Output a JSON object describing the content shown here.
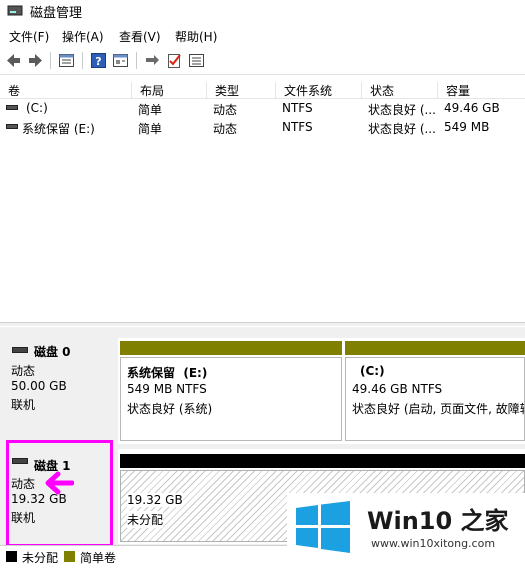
{
  "window": {
    "title": "磁盘管理"
  },
  "menu": [
    "文件(F)",
    "操作(A)",
    "查看(V)",
    "帮助(H)"
  ],
  "toolbar": {
    "icons": [
      "back-arrow-icon",
      "forward-arrow-icon",
      "properties-icon",
      "help-icon",
      "console-icon",
      "connect-icon",
      "check-icon",
      "settings-list-icon"
    ]
  },
  "volumes": {
    "headers": [
      "卷",
      "布局",
      "类型",
      "文件系统",
      "状态",
      "容量"
    ],
    "rows": [
      {
        "name": "(C:)",
        "layout": "简单",
        "type": "动态",
        "fs": "NTFS",
        "status": "状态良好 (...",
        "capacity": "49.46 GB"
      },
      {
        "name": "系统保留 (E:)",
        "layout": "简单",
        "type": "动态",
        "fs": "NTFS",
        "status": "状态良好 (...",
        "capacity": "549 MB"
      }
    ]
  },
  "disk0": {
    "name": "磁盘 0",
    "type": "动态",
    "size": "50.00 GB",
    "state": "联机",
    "partitions": [
      {
        "title": "系统保留  (E:)",
        "size": "549 MB NTFS",
        "status": "状态良好 (系统)"
      },
      {
        "title": "(C:)",
        "size": "49.46 GB NTFS",
        "status": "状态良好 (启动, 页面文件, 故障转"
      }
    ]
  },
  "disk1": {
    "name": "磁盘 1",
    "type": "动态",
    "size": "19.32 GB",
    "state": "联机",
    "partitions": [
      {
        "size": "19.32 GB",
        "status": "未分配"
      }
    ]
  },
  "legend": {
    "unallocated": "未分配",
    "simple": "简单卷"
  },
  "watermark": {
    "brand": "Win10 之家",
    "url": "www.win10xitong.com"
  },
  "colors": {
    "olive": "#808000",
    "highlight": "#ff00ff",
    "win_blue": "#1ba1e2"
  }
}
